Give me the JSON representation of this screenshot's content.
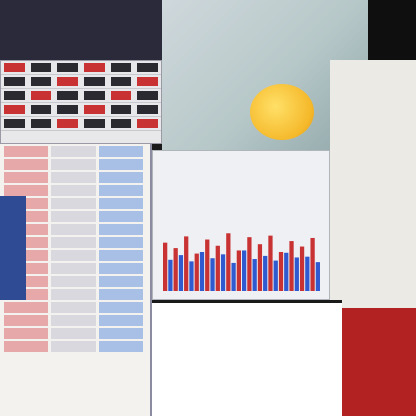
{
  "note_colors": {
    "background": "#1a1a1a",
    "price_up": "#c83232",
    "price_down": "#2f5ad0",
    "banner_blue": "#2e4b93",
    "ribbon_red": "#b32222",
    "mascot_yellow": "#f5b82a"
  },
  "quote_strip": {
    "rows": 5,
    "cols": 6
  },
  "order_book": {
    "rows": 16
  },
  "chart_data": {
    "type": "bar",
    "title": "",
    "xlabel": "",
    "ylabel": "",
    "series": [
      {
        "values": [
          0.62,
          0.55,
          0.7,
          0.48,
          0.66,
          0.58,
          0.74,
          0.52,
          0.69,
          0.6,
          0.71,
          0.5,
          0.64,
          0.57,
          0.68
        ]
      },
      {
        "values": [
          0.4,
          0.46,
          0.38,
          0.5,
          0.42,
          0.47,
          0.36,
          0.52,
          0.41,
          0.45,
          0.39,
          0.49,
          0.43,
          0.44,
          0.37
        ]
      }
    ]
  },
  "labels": {
    "date_banner": "",
    "info_card": "",
    "promo_headline": "",
    "promo_body": "",
    "side_ribbon": ""
  }
}
